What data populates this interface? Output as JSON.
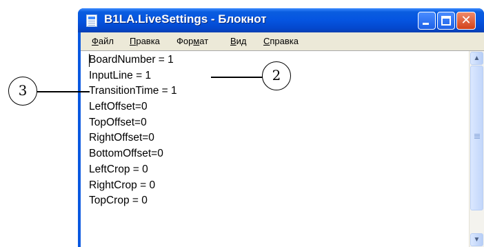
{
  "window": {
    "title": "B1LA.LiveSettings - Блокнот",
    "title_bar_color": "#0554e0",
    "controls": [
      "minimize-icon",
      "maximize-icon",
      "close-icon"
    ],
    "close_glyph": "✕"
  },
  "menu": {
    "items": [
      {
        "hotkey": "Ф",
        "rest": "айл"
      },
      {
        "hotkey": "П",
        "rest": "равка"
      },
      {
        "pre": "Фор",
        "hotkey": "м",
        "rest": "ат"
      },
      {
        "hotkey": "В",
        "rest": "ид"
      },
      {
        "hotkey": "С",
        "rest": "правка"
      }
    ]
  },
  "editor": {
    "lines": [
      "BoardNumber = 1",
      "InputLine = 1",
      "TransitionTime = 1",
      "LeftOffset=0",
      "TopOffset=0",
      "RightOffset=0",
      "BottomOffset=0",
      "LeftCrop = 0",
      "RightCrop = 0",
      "TopCrop = 0"
    ]
  },
  "scrollbar": {
    "up_glyph": "▲",
    "down_glyph": "▼"
  },
  "callouts": [
    {
      "label": "2"
    },
    {
      "label": "3"
    }
  ]
}
